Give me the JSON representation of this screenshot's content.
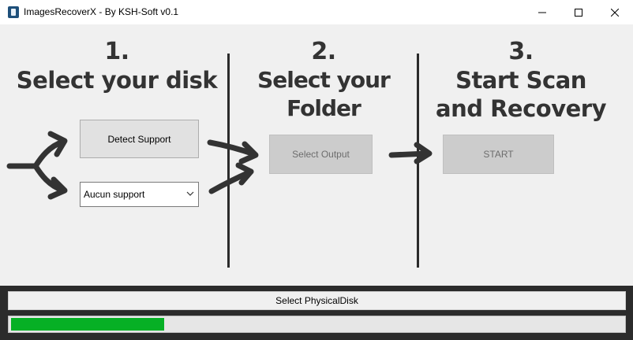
{
  "window": {
    "title": "ImagesRecoverX - By KSH-Soft v0.1",
    "icon": "app-icon",
    "controls": [
      "minimize-icon",
      "maximize-icon",
      "close-icon"
    ]
  },
  "steps": [
    {
      "number": "1.",
      "title": "Select your disk"
    },
    {
      "number": "2.",
      "title": "Select your Folder"
    },
    {
      "number": "3.",
      "title_line1": "Start Scan",
      "title_line2": "and Recovery"
    }
  ],
  "buttons": {
    "detect_support": "Detect Support",
    "select_output": "Select Output",
    "start": "START"
  },
  "disk_combo": {
    "selected": "Aucun support",
    "icon": "chevron-down-icon"
  },
  "status": {
    "label": "Select PhysicalDisk",
    "progress": 0.25
  },
  "colors": {
    "heading": "#333333",
    "divider": "#2b2b2b",
    "progress_fill": "#06b025"
  }
}
